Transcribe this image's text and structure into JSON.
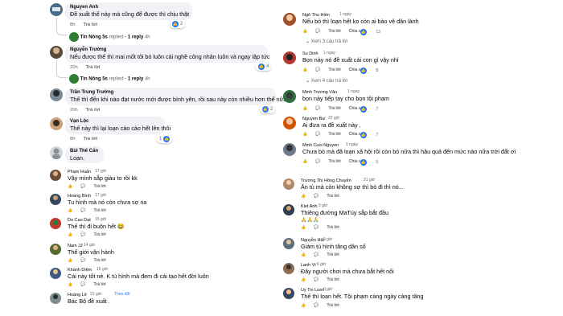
{
  "left": [
    {
      "name": "Nguyen Anh",
      "text": "Đề xuất thế này mà cũng để được thì chịu thật",
      "time": "8h",
      "reply": "Trả lời",
      "likes": "2"
    },
    {
      "reply_summary": {
        "author": "Tin Nông 5s",
        "action": "replied",
        "count": "· 1 reply",
        "time": "4h"
      }
    },
    {
      "name": "Nguyễn Trường",
      "text": "Nếu được thế thì mai mốt tôi bỏ luôn cái nghề công nhân luôn và ngay lập tức",
      "time": "20h",
      "reply": "Trả lời",
      "likes": "4"
    },
    {
      "reply_summary": {
        "author": "Tin Nông 5s",
        "action": "replied",
        "count": "· 1 reply",
        "time": "4h"
      }
    },
    {
      "name": "Trần Trung Trường",
      "text": "Thế thì đến khi nào đạt nước mới được bình yên, rồi sau này còn nhiều hơn thế nữa",
      "time": "20h",
      "reply": "Trả lời",
      "likes": "2"
    },
    {
      "name": "Vạn Lộc",
      "text": "Thế này thì lại loạn cào cào hết lên thôi",
      "time": "8h",
      "reply": "Trả lời",
      "likes": "1"
    },
    {
      "name": "Bùi Thế Cẩn",
      "text": "Loạn.",
      "time": "",
      "reply": "",
      "likes": ""
    },
    {
      "name": "Phạm Huấn",
      "text": "Vậy mình sắp giàu to rồi kk",
      "time": "17 giờ",
      "reply": "Trả lời"
    },
    {
      "name": "Hoàng Bình",
      "text": "Tu hình mà nó còn chưa sợ na",
      "time": "17 giờ",
      "reply": "Trả lời"
    },
    {
      "name": "Do Cao Dat",
      "text": "Thế thì đi buôn hết 😂",
      "time": "15 giờ",
      "reply": "Trả lời"
    },
    {
      "name": "Nam JJ",
      "text": "Thế giới vận hành",
      "time": "14 giờ",
      "reply": "Trả lời"
    },
    {
      "name": "Khánh Diệm",
      "text": "Cái này tốt nè. K tù hình mà đem đi cải tạo hết đời luôn",
      "time": "16 giờ",
      "reply": "Trả lời"
    },
    {
      "name": "Hoàng Lê",
      "text": "Bác Bộ đề xuất .",
      "time": "21 giờ",
      "reply": "",
      "follow": "Theo dõi"
    }
  ],
  "right": [
    {
      "name": "Ngô Thu Hiền",
      "time_inline": "1 ngày",
      "text": "Nếu bỏ thì loạn hết ko còn ai bảo vệ dân lành",
      "time": "1 ngày",
      "reply": "Trả lời",
      "share": "Chia sẻ",
      "likes": "13"
    },
    {
      "more": "Xem 3 câu trả lời"
    },
    {
      "name": "Su Dinh",
      "time_inline": "1 ngày",
      "text": "Bọn này nó đề xuất cái con gì vậy nhỉ",
      "time": "1 ngày",
      "reply": "Trả lời",
      "share": "Chia sẻ",
      "likes": "8"
    },
    {
      "more": "Xem 4 câu trả lời"
    },
    {
      "name": "Minh Trương Văn",
      "time_inline": "1 ngày",
      "text": "bọn này tiếp tay cho bọn tội phạm",
      "time": "1 ngày",
      "reply": "Trả lời",
      "share": "Chia sẻ",
      "likes": "7"
    },
    {
      "name": "Nguyen Bui",
      "time_inline": "22 giờ",
      "text": "Ai đưa ra đề xuất này ,",
      "time": "22 giờ",
      "reply": "Trả lời",
      "share": "Chia sẻ",
      "likes": "7"
    },
    {
      "name": "Minh Cuoi Nguyen",
      "time_inline": "1 ngày",
      "text": "Chưa bỏ mà đã loạn xã hội rồi còn bỏ nữa thì hậu quả đến mức nào nữa trời đất ơi",
      "time": "1 ngày",
      "reply": "Trả lời",
      "share": "Chia sẻ",
      "likes": "5"
    },
    {
      "name": "Trương Thị Hồng Chuyên",
      "time_inline": "21 giờ",
      "text": "Ăn tù mà còn không sợ thì bỏ đi thì nó...",
      "time": "21 giờ",
      "reply": "Trả lời"
    },
    {
      "name": "Kiet Anh",
      "time_inline": "9 giờ",
      "text": "Thiêng đường MaTúy sắp bắt đầu",
      "time": "9 giờ",
      "reply": "Trả lời",
      "extra": "🙏🙏🙏"
    },
    {
      "name": "Nguyễn Hải",
      "time_inline": "9 giờ",
      "text": "Giảm tù hình tăng dân số",
      "time": "9 giờ",
      "reply": "Trả lời"
    },
    {
      "name": "Lanh Vi",
      "time_inline": "6 giờ",
      "text": "Đây người chơi mà chưa bắt hết nổi",
      "time": "6 giờ",
      "reply": "Trả lời"
    },
    {
      "name": "Uy Tin Luon",
      "time_inline": "6 giờ",
      "text": "Thế thì loạn hết. Tội phạm càng ngày càng tăng",
      "time": "6 giờ",
      "reply": "Trả lời"
    }
  ],
  "colors": {
    "bubble": "#f0f2f5",
    "meta": "#65676b",
    "accent": "#1877f2"
  }
}
